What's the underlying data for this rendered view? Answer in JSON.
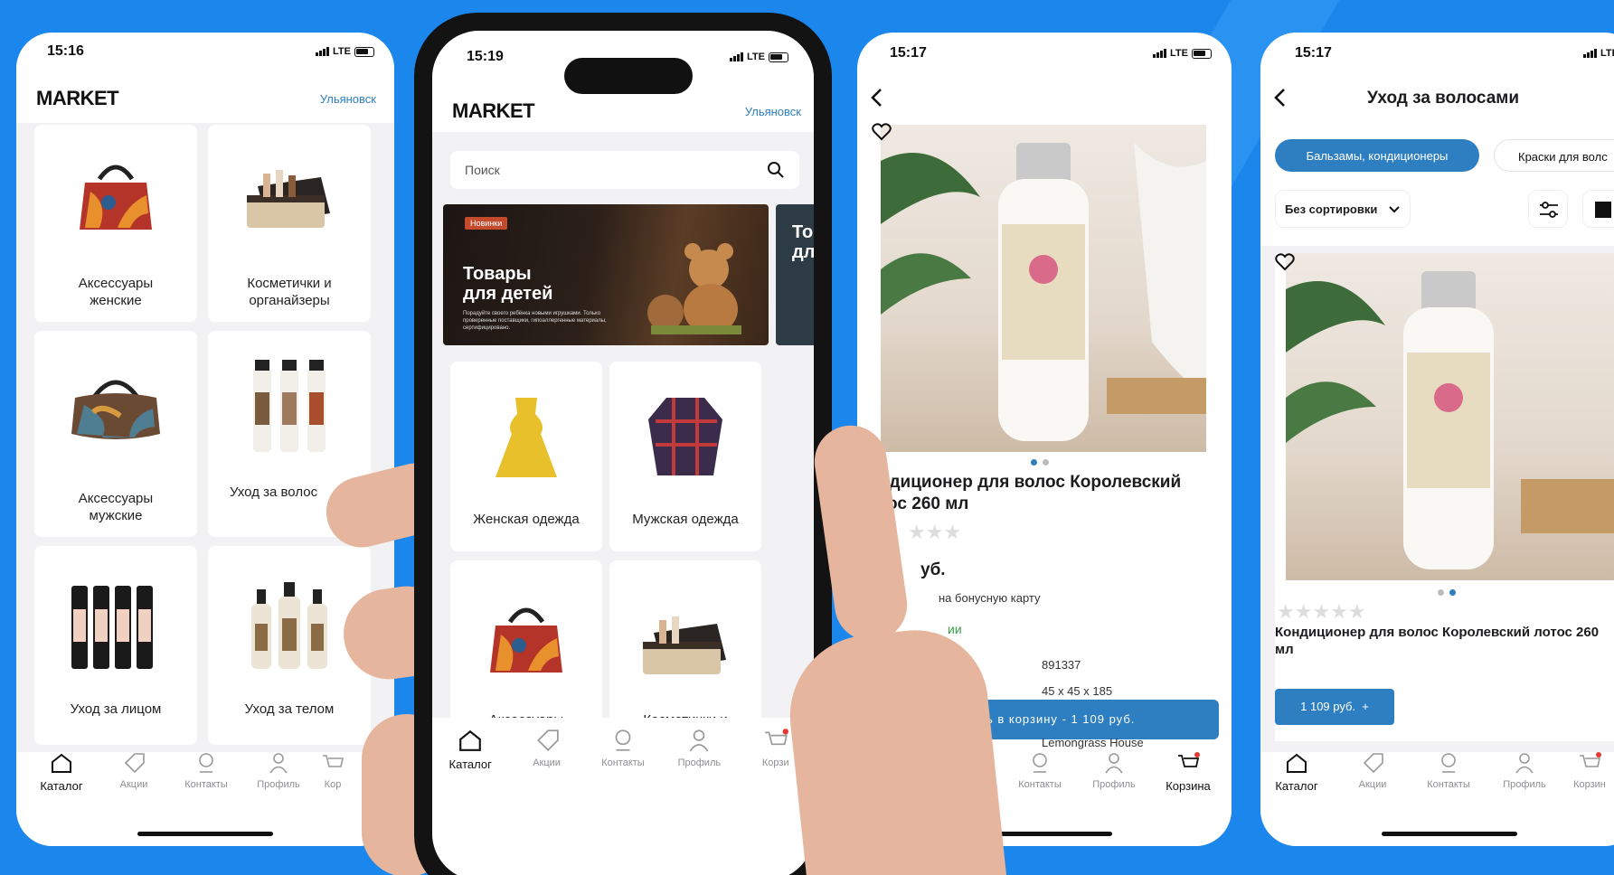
{
  "screens": [
    {
      "time": "15:16",
      "network": "LTE",
      "title": "MARKET",
      "city": "Ульяновск",
      "categories": [
        "Аксессуары женские",
        "Косметички и органайзеры",
        "Аксессуары мужские",
        "Уход за волос",
        "Уход за лицом",
        "Уход за телом"
      ],
      "tabs": [
        "Каталог",
        "Акции",
        "Контакты",
        "Профиль",
        "Кор"
      ]
    },
    {
      "time": "15:19",
      "network": "LTE",
      "title": "MARKET",
      "city": "Ульяновск",
      "search_placeholder": "Поиск",
      "banner": {
        "badge": "Новинки",
        "title": "Товары\nдля детей",
        "subtitle": "Порадуйте своего ребёнка новыми игрушками. Только проверенные поставщики, гипоаллергенные материалы, сертифицировано.",
        "next_title": "То\nдл"
      },
      "categories": [
        "Женская одежда",
        "Мужская одежда",
        "Аксессуары",
        "Косметички и"
      ],
      "tabs": [
        "Каталог",
        "Акции",
        "Контакты",
        "Профиль",
        "Корзи"
      ]
    },
    {
      "time": "15:17",
      "network": "LTE",
      "product_title": "ндиционер для волос Королевский\nтос 260 мл",
      "price": "уб.",
      "bonus_text": "на бонусную карту",
      "stock_text": "ии",
      "article": "891337",
      "dimensions": "45 x 45 x 185",
      "brand": "Lemongrass House",
      "cart_button": "ть в корзину - 1 109 руб.",
      "tabs": [
        "Контакты",
        "Профиль",
        "Корзина"
      ]
    },
    {
      "time": "15:17",
      "network": "LTE",
      "title": "Уход за волосами",
      "chips": [
        "Бальзамы, кондиционеры",
        "Краски для волс"
      ],
      "sort_label": "Без сортировки",
      "product_title": "Кондиционер для волос Королевский лотос 260\nмл",
      "price_button": "1 109 руб.  +",
      "tabs": [
        "Каталог",
        "Акции",
        "Контакты",
        "Профиль",
        "Корзин"
      ]
    }
  ],
  "colors": {
    "background": "#1b86ec",
    "accent": "#2d7fc2",
    "text": "#1c1c1e"
  }
}
